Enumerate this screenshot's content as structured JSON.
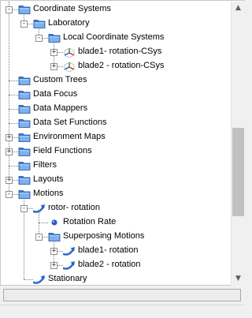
{
  "tree": {
    "nodes": [
      {
        "label": "Coordinate Systems",
        "icon": "folder-open-icon",
        "toggle": "-"
      },
      {
        "label": "Laboratory",
        "icon": "folder-open-icon",
        "toggle": "-"
      },
      {
        "label": "Local Coordinate Systems",
        "icon": "folder-open-icon",
        "toggle": "-"
      },
      {
        "label": "blade1- rotation-CSys",
        "icon": "coordinate-axes-icon",
        "toggle": "+"
      },
      {
        "label": "blade2 - rotation-CSys",
        "icon": "coordinate-axes-icon",
        "toggle": "+"
      },
      {
        "label": "Custom Trees",
        "icon": "folder-icon"
      },
      {
        "label": "Data Focus",
        "icon": "folder-icon"
      },
      {
        "label": "Data Mappers",
        "icon": "folder-icon"
      },
      {
        "label": "Data Set Functions",
        "icon": "folder-icon"
      },
      {
        "label": "Environment Maps",
        "icon": "folder-icon",
        "toggle": "+"
      },
      {
        "label": "Field Functions",
        "icon": "folder-icon",
        "toggle": "+"
      },
      {
        "label": "Filters",
        "icon": "folder-icon"
      },
      {
        "label": "Layouts",
        "icon": "folder-icon",
        "toggle": "+"
      },
      {
        "label": "Motions",
        "icon": "folder-open-icon",
        "toggle": "-"
      },
      {
        "label": "rotor- rotation",
        "icon": "rotation-motion-icon",
        "toggle": "-"
      },
      {
        "label": "Rotation Rate",
        "icon": "bullet-icon"
      },
      {
        "label": "Superposing Motions",
        "icon": "folder-open-icon",
        "toggle": "-"
      },
      {
        "label": "blade1- rotation",
        "icon": "rotation-motion-icon",
        "toggle": "+"
      },
      {
        "label": "blade2 - rotation",
        "icon": "rotation-motion-icon",
        "toggle": "+"
      },
      {
        "label": "Stationary",
        "icon": "rotation-motion-icon"
      }
    ]
  },
  "colors": {
    "folder": "#3a78d6",
    "folder_light": "#7fb0ee",
    "motion": "#2a5fc4",
    "bullet": "#2860c8"
  }
}
